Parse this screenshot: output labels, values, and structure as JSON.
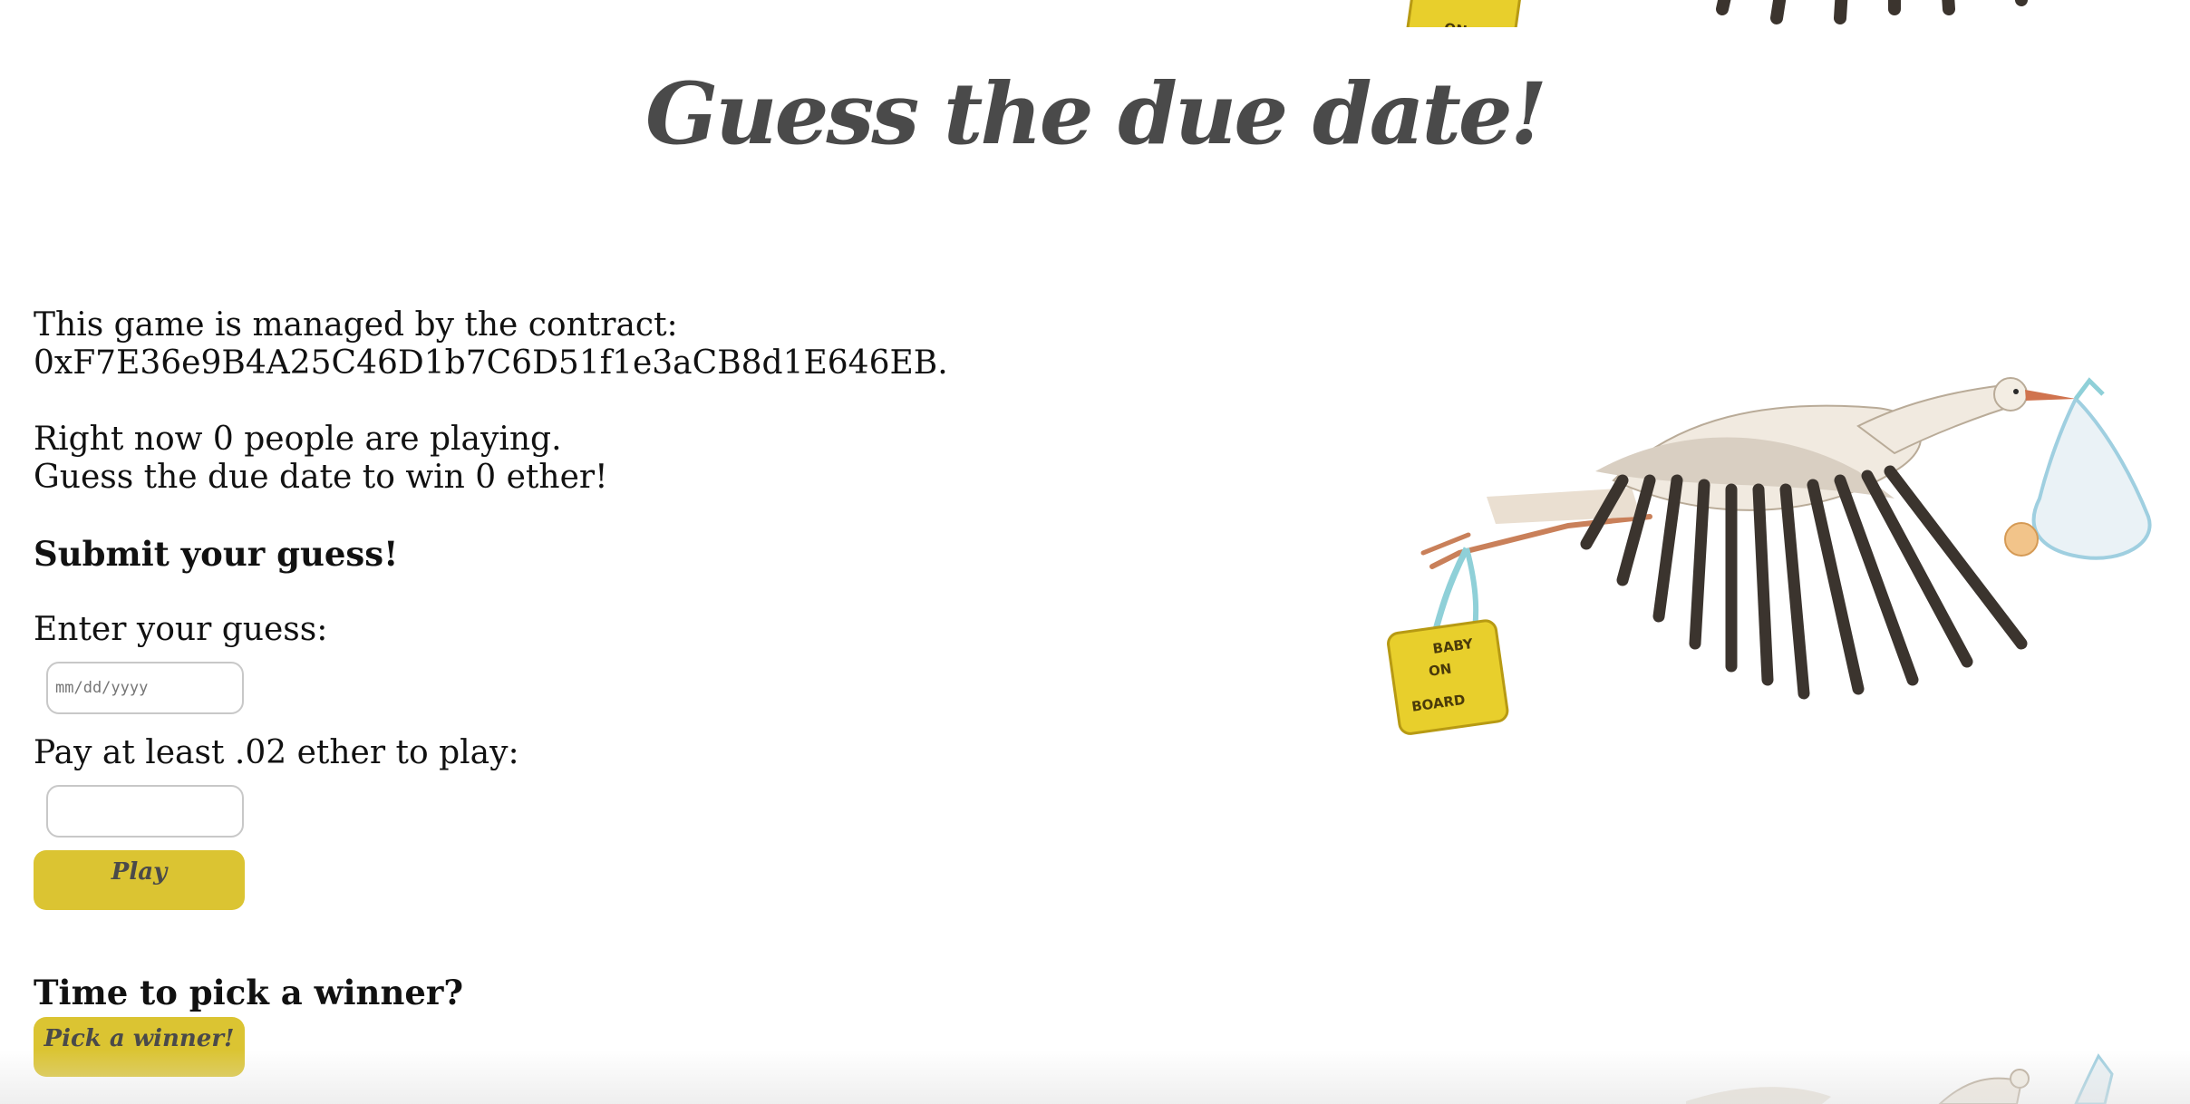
{
  "page": {
    "title": "Guess the due date!"
  },
  "contract": {
    "line1": "This game is managed by the contract:",
    "address": "0xF7E36e9B4A25C46D1b7C6D51f1e3aCB8d1E646EB."
  },
  "status": {
    "players_line": "Right now 0 people are playing.",
    "prize_line": "Guess the due date to win 0 ether!"
  },
  "submit": {
    "heading": "Submit your guess!",
    "guess_label": "Enter your guess:",
    "date_placeholder": "mm/dd/yyyy",
    "pay_label": "Pay at least .02 ether to play:",
    "ether_value": "",
    "play_button": "Play"
  },
  "winner": {
    "heading": "Time to pick a winner?",
    "pick_button": "Pick a winner!"
  },
  "decor": {
    "sign_text": [
      "BABY",
      "ON",
      "BOARD"
    ]
  },
  "colors": {
    "button_bg": "#dbc432",
    "title_color": "#4a4a4a",
    "input_border": "#c8c8c8"
  }
}
